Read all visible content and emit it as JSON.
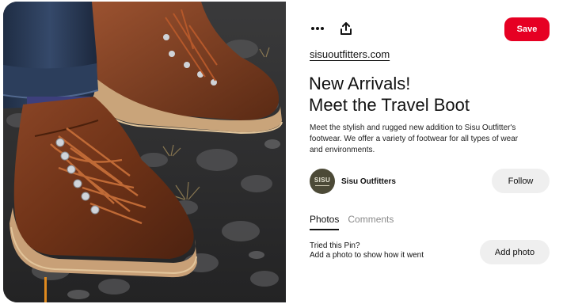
{
  "pin": {
    "image_alt": "Brown leather hiking boots on rocky ground",
    "domain": "sisuoutfitters.com",
    "title_line1": "New Arrivals!",
    "title_line2": "Meet the Travel Boot",
    "description": "Meet the stylish and rugged new addition to Sisu Outfitter's footwear. We offer a variety of footwear for all types of wear and environments."
  },
  "toolbar": {
    "more_icon": "more-icon",
    "share_icon": "share-icon",
    "save_label": "Save"
  },
  "creator": {
    "avatar_text": "SISU",
    "name": "Sisu Outfitters",
    "follow_label": "Follow"
  },
  "tabs": [
    {
      "label": "Photos",
      "active": true
    },
    {
      "label": "Comments",
      "active": false
    }
  ],
  "tried": {
    "line1": "Tried this Pin?",
    "line2": "Add a photo to show how it went",
    "button_label": "Add photo"
  },
  "colors": {
    "save_bg": "#e60023",
    "button_bg": "#efefef",
    "text": "#111111",
    "muted": "#8a8a8a",
    "avatar_bg": "#4c4a37"
  }
}
